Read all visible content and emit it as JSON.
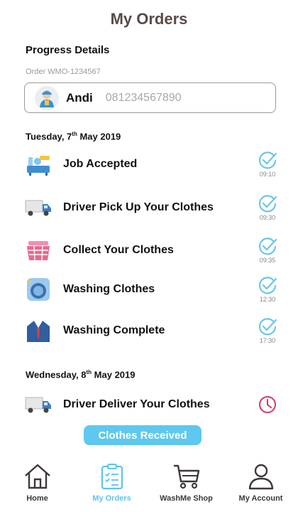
{
  "header": {
    "title": "My Orders"
  },
  "progress": {
    "section_title": "Progress Details",
    "order_id": "Order WMO-1234567"
  },
  "driver": {
    "name": "Andi",
    "phone": "081234567890"
  },
  "groups": [
    {
      "date_day": "Tuesday, 7",
      "date_suffix": "th",
      "date_rest": " May 2019"
    },
    {
      "date_day": "Wednesday, 8",
      "date_suffix": "th",
      "date_rest": " May 2019"
    }
  ],
  "steps": [
    {
      "label": "Job Accepted",
      "time": "09:10",
      "status": "done",
      "icon": "job-accepted-icon"
    },
    {
      "label": "Driver Pick Up Your Clothes",
      "time": "09:30",
      "status": "done",
      "icon": "truck-icon"
    },
    {
      "label": "Collect Your Clothes",
      "time": "09:35",
      "status": "done",
      "icon": "laundry-basket-icon"
    },
    {
      "label": "Washing Clothes",
      "time": "12:30",
      "status": "done",
      "icon": "washing-machine-icon"
    },
    {
      "label": "Washing Complete",
      "time": "17:30",
      "status": "done",
      "icon": "suit-icon"
    },
    {
      "label": "Driver Deliver Your Clothes",
      "time": "",
      "status": "pending",
      "icon": "truck-icon"
    }
  ],
  "action": {
    "received_label": "Clothes Received"
  },
  "nav": [
    {
      "label": "Home",
      "icon": "home-icon",
      "active": false
    },
    {
      "label": "My Orders",
      "icon": "clipboard-icon",
      "active": true
    },
    {
      "label": "WashMe Shop",
      "icon": "cart-icon",
      "active": false
    },
    {
      "label": "My Account",
      "icon": "user-icon",
      "active": false
    }
  ],
  "colors": {
    "accent": "#5FC8EF",
    "check": "#6CC6E8",
    "pending": "#D9365E",
    "title": "#5B4A4A"
  }
}
